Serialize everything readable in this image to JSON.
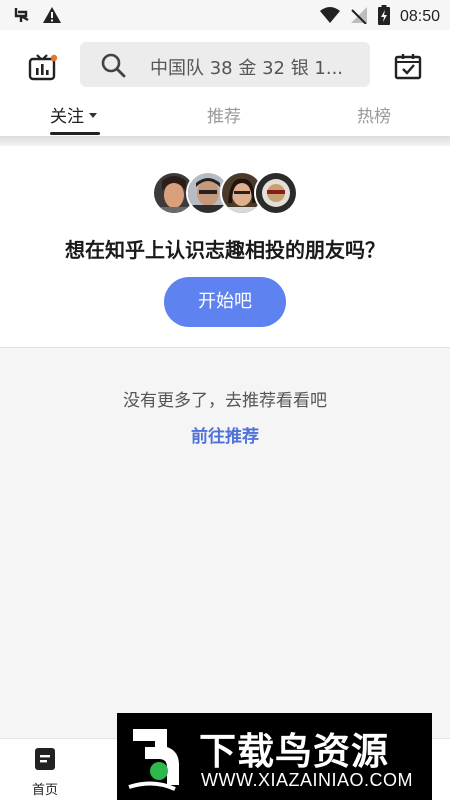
{
  "status_bar": {
    "time": "08:50",
    "left_icons": [
      "bug-icon",
      "warning-icon"
    ],
    "right_icons": [
      "wifi-icon",
      "signal-icon",
      "battery-icon"
    ]
  },
  "header": {
    "search_placeholder": "中国队 38 金 32 银 1...",
    "tabs": [
      {
        "label": "关注",
        "active": true,
        "has_dropdown": true
      },
      {
        "label": "推荐",
        "active": false
      },
      {
        "label": "热榜",
        "active": false
      }
    ],
    "left_icon": "live-tv-icon",
    "right_icon": "calendar-check-icon"
  },
  "friends_card": {
    "title": "想在知乎上认识志趣相投的朋友吗？",
    "button_label": "开始吧",
    "avatar_count": 4
  },
  "empty_state": {
    "text": "没有更多了，去推荐看看吧",
    "link_text": "前往推荐"
  },
  "bottom_nav": {
    "items": [
      {
        "label": "首页",
        "icon": "home-icon",
        "active": true
      }
    ]
  },
  "watermark": {
    "title": "下载鸟资源",
    "url": "WWW.XIAZAINIAO.COM"
  },
  "colors": {
    "accent": "#5e82f0",
    "link": "#4e72d8",
    "background": "#f5f5f5"
  }
}
